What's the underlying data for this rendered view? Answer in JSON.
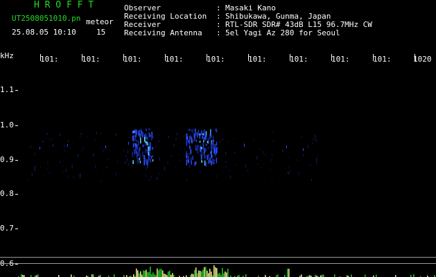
{
  "header": {
    "logo": "H R O F F T",
    "filename": "UT2508051010.pn",
    "tag": "meteor",
    "datetime": "25.08.05 10:10",
    "count": "15"
  },
  "info": [
    {
      "label": "Observer",
      "sep": ":",
      "value": "Masaki Kano"
    },
    {
      "label": "Receiving Location",
      "sep": ":",
      "value": "Shibukawa, Gunma, Japan"
    },
    {
      "label": "Receiver",
      "sep": ":",
      "value": "RTL-SDR SDR# 43dB L15 96.7MHz CW"
    },
    {
      "label": "Receiving Antenna",
      "sep": ":",
      "value": "5el Yagi Az 280 for Seoul"
    }
  ],
  "axis": {
    "unit": "kHz",
    "x_labels": [
      "101:",
      "101:",
      "101:",
      "101:",
      "101:",
      "101:",
      "101:",
      "101:",
      "101:",
      "1020"
    ],
    "y_labels": [
      "1.1",
      "1.0",
      "0.9",
      "0.8",
      "0.7",
      "0.6"
    ]
  },
  "colors": {
    "background": "#000000",
    "header_green": "#22dd22",
    "meteor_blue": "#2a4dff",
    "meteor_cyan": "#55ddff",
    "histogram_yellow": "#f2f28a",
    "histogram_green": "#22cc22",
    "separator_gray": "#9a9a9a"
  }
}
